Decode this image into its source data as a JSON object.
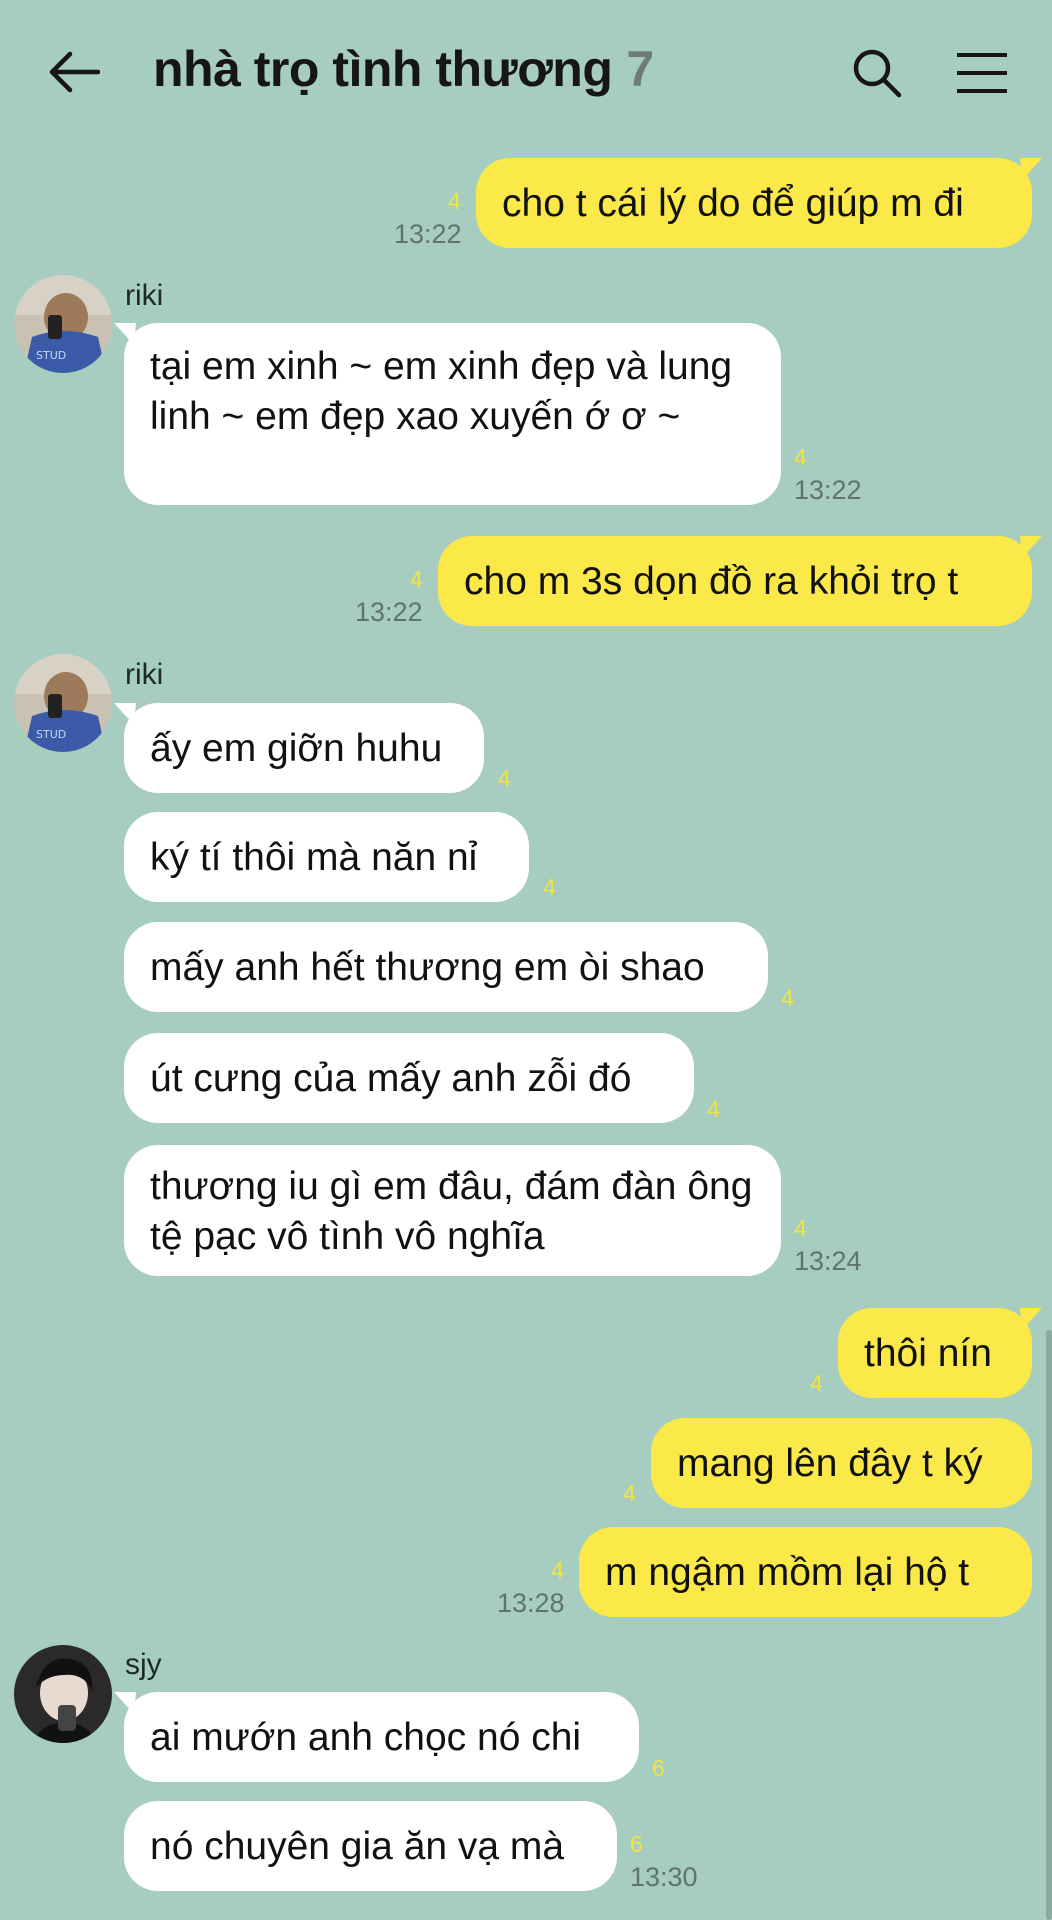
{
  "header": {
    "title": "nhà trọ tình thương",
    "member_count": "7",
    "back_icon": "arrow-left-icon",
    "search_icon": "search-icon",
    "menu_icon": "hamburger-menu-icon"
  },
  "colors": {
    "background": "#a6cdbf",
    "my_bubble": "#fbe94a",
    "other_bubble": "#ffffff",
    "unread_count": "#f1e540"
  },
  "messages": [
    {
      "sender": "me",
      "text": "cho t cái lý do để giúp m đi",
      "unread": "4",
      "time": "13:22"
    },
    {
      "sender": "riki",
      "sender_label": "riki",
      "text": "tại em xinh ~ em xinh đẹp và lung linh ~ em đẹp xao xuyến ớ ơ ~",
      "unread": "4",
      "time": "13:22"
    },
    {
      "sender": "me",
      "text": "cho m 3s dọn đồ ra khỏi trọ t",
      "unread": "4",
      "time": "13:22"
    },
    {
      "sender": "riki",
      "sender_label": "riki",
      "text": "ấy em giỡn huhu",
      "unread": "4"
    },
    {
      "sender": "riki",
      "text": "ký tí thôi mà năn nỉ",
      "unread": "4"
    },
    {
      "sender": "riki",
      "text": "mấy anh hết thương em òi shao",
      "unread": "4"
    },
    {
      "sender": "riki",
      "text": "út cưng của mấy anh zỗi đó",
      "unread": "4"
    },
    {
      "sender": "riki",
      "text": "thương iu gì em đâu, đám đàn ông tệ pạc vô tình vô nghĩa",
      "unread": "4",
      "time": "13:24"
    },
    {
      "sender": "me",
      "text": "thôi nín",
      "unread": "4"
    },
    {
      "sender": "me",
      "text": "mang lên đây t ký",
      "unread": "4"
    },
    {
      "sender": "me",
      "text": "m ngậm mồm lại hộ t",
      "unread": "4",
      "time": "13:28"
    },
    {
      "sender": "sjy",
      "sender_label": "sjy",
      "text": "ai mướn anh chọc nó chi",
      "unread": "6"
    },
    {
      "sender": "sjy",
      "text": "nó chuyên gia ăn vạ mà",
      "unread": "6",
      "time": "13:30"
    }
  ]
}
